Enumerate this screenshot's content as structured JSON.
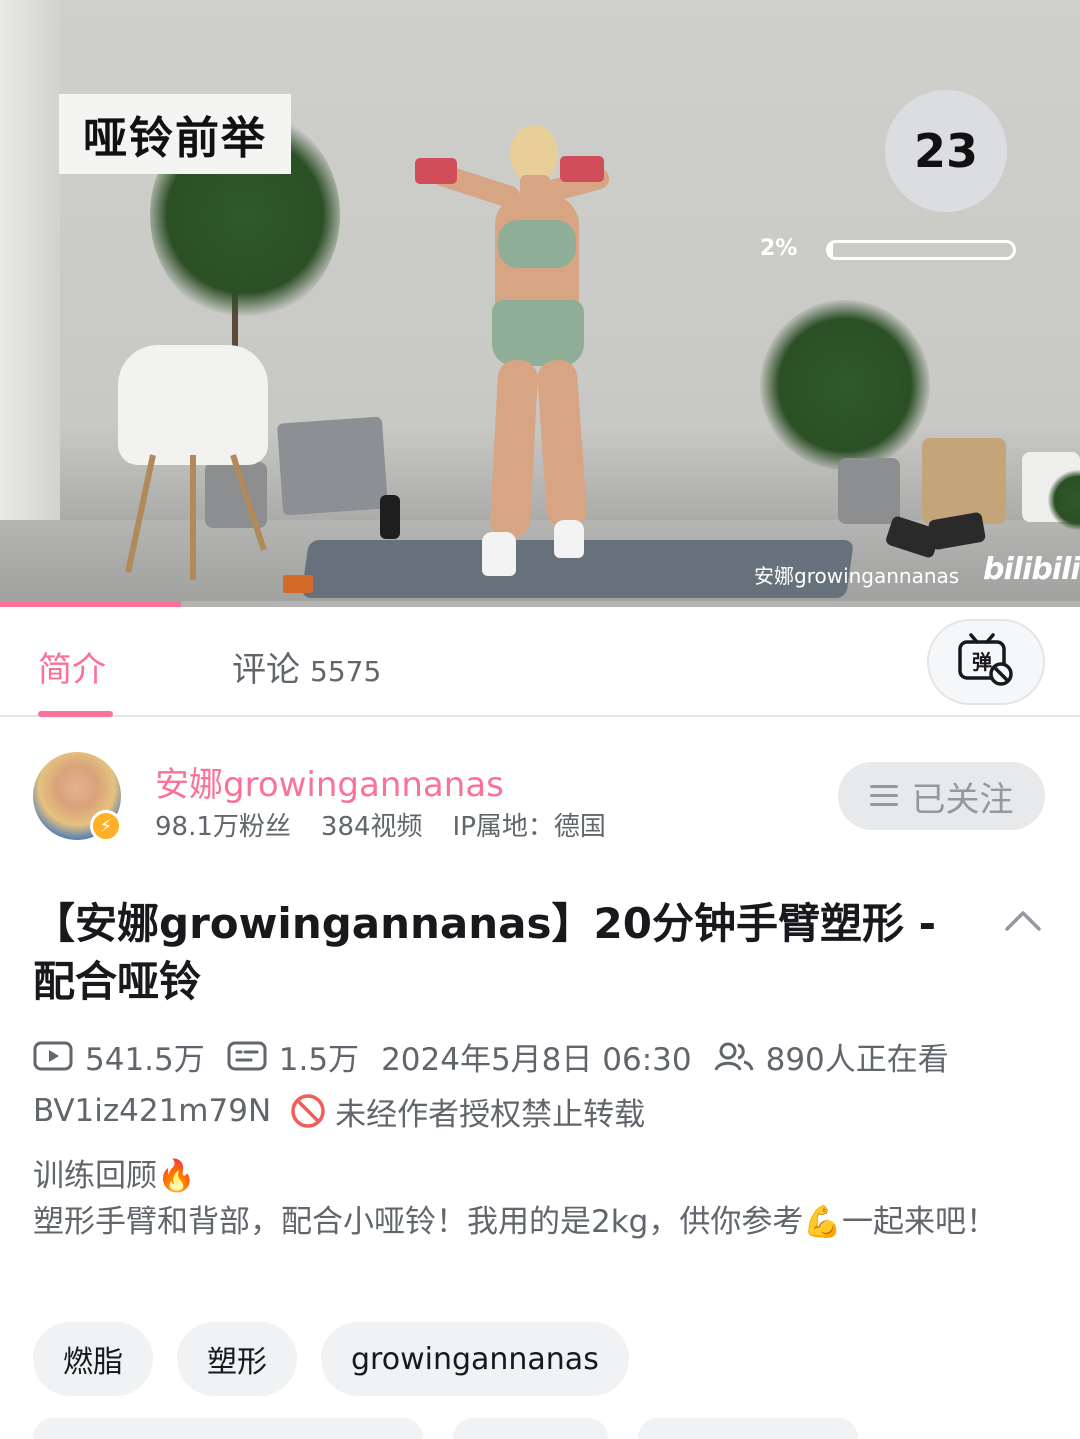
{
  "video": {
    "exercise_label": "哑铃前举",
    "rep_counter": "23",
    "progress_text": "2%",
    "progress_fraction": 0.02,
    "watermark_text": "安娜growingannanas",
    "watermark_logo": "bilibili",
    "playback_progress_fraction": 0.168
  },
  "tabs": {
    "intro_label": "简介",
    "comments_label": "评论",
    "comments_count": "5575",
    "danmaku_icon": "danmaku-off-icon"
  },
  "uploader": {
    "name": "安娜growingannanas",
    "fans": "98.1万粉丝",
    "videos": "384视频",
    "ip_location": "IP属地：德国",
    "follow_label": "已关注"
  },
  "video_info": {
    "title": "【安娜growingannanas】20分钟手臂塑形 - 配合哑铃",
    "views": "541.5万",
    "danmaku_count": "1.5万",
    "publish_time": "2024年5月8日 06:30",
    "watching_now": "890人正在看",
    "bvid": "BV1iz421m79N",
    "copyright_notice": "未经作者授权禁止转载"
  },
  "description": {
    "line1": "训练回顾🔥",
    "line2": "塑形手臂和背部，配合小哑铃！我用的是2kg，供你参考💪一起来吧！"
  },
  "tags": [
    "燃脂",
    "塑形",
    "growingannanas"
  ],
  "colors": {
    "accent": "#fb7299",
    "text_primary": "#18191c",
    "text_secondary": "#61666d",
    "chip_bg": "#f1f2f3",
    "badge": "#ffb027"
  }
}
